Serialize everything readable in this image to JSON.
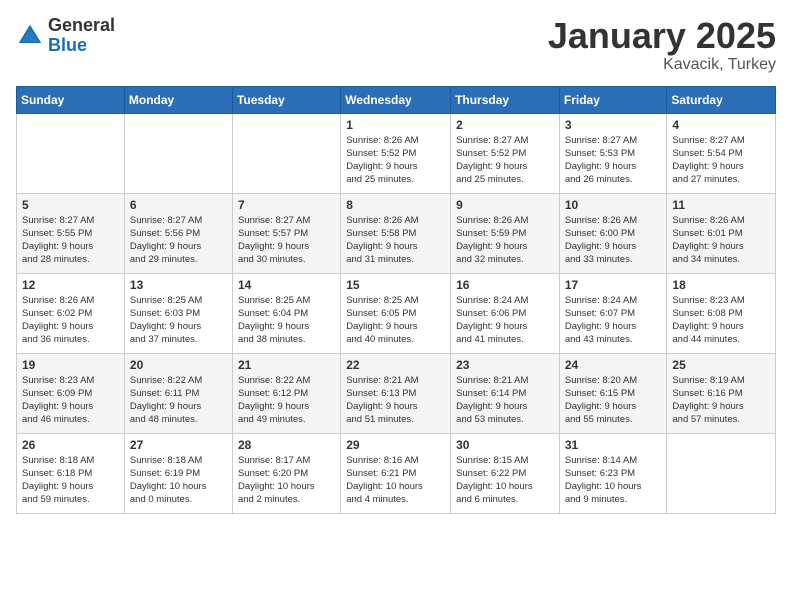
{
  "logo": {
    "general": "General",
    "blue": "Blue"
  },
  "title": "January 2025",
  "location": "Kavacik, Turkey",
  "days_header": [
    "Sunday",
    "Monday",
    "Tuesday",
    "Wednesday",
    "Thursday",
    "Friday",
    "Saturday"
  ],
  "weeks": [
    [
      {
        "day": "",
        "info": ""
      },
      {
        "day": "",
        "info": ""
      },
      {
        "day": "",
        "info": ""
      },
      {
        "day": "1",
        "info": "Sunrise: 8:26 AM\nSunset: 5:52 PM\nDaylight: 9 hours\nand 25 minutes."
      },
      {
        "day": "2",
        "info": "Sunrise: 8:27 AM\nSunset: 5:52 PM\nDaylight: 9 hours\nand 25 minutes."
      },
      {
        "day": "3",
        "info": "Sunrise: 8:27 AM\nSunset: 5:53 PM\nDaylight: 9 hours\nand 26 minutes."
      },
      {
        "day": "4",
        "info": "Sunrise: 8:27 AM\nSunset: 5:54 PM\nDaylight: 9 hours\nand 27 minutes."
      }
    ],
    [
      {
        "day": "5",
        "info": "Sunrise: 8:27 AM\nSunset: 5:55 PM\nDaylight: 9 hours\nand 28 minutes."
      },
      {
        "day": "6",
        "info": "Sunrise: 8:27 AM\nSunset: 5:56 PM\nDaylight: 9 hours\nand 29 minutes."
      },
      {
        "day": "7",
        "info": "Sunrise: 8:27 AM\nSunset: 5:57 PM\nDaylight: 9 hours\nand 30 minutes."
      },
      {
        "day": "8",
        "info": "Sunrise: 8:26 AM\nSunset: 5:58 PM\nDaylight: 9 hours\nand 31 minutes."
      },
      {
        "day": "9",
        "info": "Sunrise: 8:26 AM\nSunset: 5:59 PM\nDaylight: 9 hours\nand 32 minutes."
      },
      {
        "day": "10",
        "info": "Sunrise: 8:26 AM\nSunset: 6:00 PM\nDaylight: 9 hours\nand 33 minutes."
      },
      {
        "day": "11",
        "info": "Sunrise: 8:26 AM\nSunset: 6:01 PM\nDaylight: 9 hours\nand 34 minutes."
      }
    ],
    [
      {
        "day": "12",
        "info": "Sunrise: 8:26 AM\nSunset: 6:02 PM\nDaylight: 9 hours\nand 36 minutes."
      },
      {
        "day": "13",
        "info": "Sunrise: 8:25 AM\nSunset: 6:03 PM\nDaylight: 9 hours\nand 37 minutes."
      },
      {
        "day": "14",
        "info": "Sunrise: 8:25 AM\nSunset: 6:04 PM\nDaylight: 9 hours\nand 38 minutes."
      },
      {
        "day": "15",
        "info": "Sunrise: 8:25 AM\nSunset: 6:05 PM\nDaylight: 9 hours\nand 40 minutes."
      },
      {
        "day": "16",
        "info": "Sunrise: 8:24 AM\nSunset: 6:06 PM\nDaylight: 9 hours\nand 41 minutes."
      },
      {
        "day": "17",
        "info": "Sunrise: 8:24 AM\nSunset: 6:07 PM\nDaylight: 9 hours\nand 43 minutes."
      },
      {
        "day": "18",
        "info": "Sunrise: 8:23 AM\nSunset: 6:08 PM\nDaylight: 9 hours\nand 44 minutes."
      }
    ],
    [
      {
        "day": "19",
        "info": "Sunrise: 8:23 AM\nSunset: 6:09 PM\nDaylight: 9 hours\nand 46 minutes."
      },
      {
        "day": "20",
        "info": "Sunrise: 8:22 AM\nSunset: 6:11 PM\nDaylight: 9 hours\nand 48 minutes."
      },
      {
        "day": "21",
        "info": "Sunrise: 8:22 AM\nSunset: 6:12 PM\nDaylight: 9 hours\nand 49 minutes."
      },
      {
        "day": "22",
        "info": "Sunrise: 8:21 AM\nSunset: 6:13 PM\nDaylight: 9 hours\nand 51 minutes."
      },
      {
        "day": "23",
        "info": "Sunrise: 8:21 AM\nSunset: 6:14 PM\nDaylight: 9 hours\nand 53 minutes."
      },
      {
        "day": "24",
        "info": "Sunrise: 8:20 AM\nSunset: 6:15 PM\nDaylight: 9 hours\nand 55 minutes."
      },
      {
        "day": "25",
        "info": "Sunrise: 8:19 AM\nSunset: 6:16 PM\nDaylight: 9 hours\nand 57 minutes."
      }
    ],
    [
      {
        "day": "26",
        "info": "Sunrise: 8:18 AM\nSunset: 6:18 PM\nDaylight: 9 hours\nand 59 minutes."
      },
      {
        "day": "27",
        "info": "Sunrise: 8:18 AM\nSunset: 6:19 PM\nDaylight: 10 hours\nand 0 minutes."
      },
      {
        "day": "28",
        "info": "Sunrise: 8:17 AM\nSunset: 6:20 PM\nDaylight: 10 hours\nand 2 minutes."
      },
      {
        "day": "29",
        "info": "Sunrise: 8:16 AM\nSunset: 6:21 PM\nDaylight: 10 hours\nand 4 minutes."
      },
      {
        "day": "30",
        "info": "Sunrise: 8:15 AM\nSunset: 6:22 PM\nDaylight: 10 hours\nand 6 minutes."
      },
      {
        "day": "31",
        "info": "Sunrise: 8:14 AM\nSunset: 6:23 PM\nDaylight: 10 hours\nand 9 minutes."
      },
      {
        "day": "",
        "info": ""
      }
    ]
  ]
}
